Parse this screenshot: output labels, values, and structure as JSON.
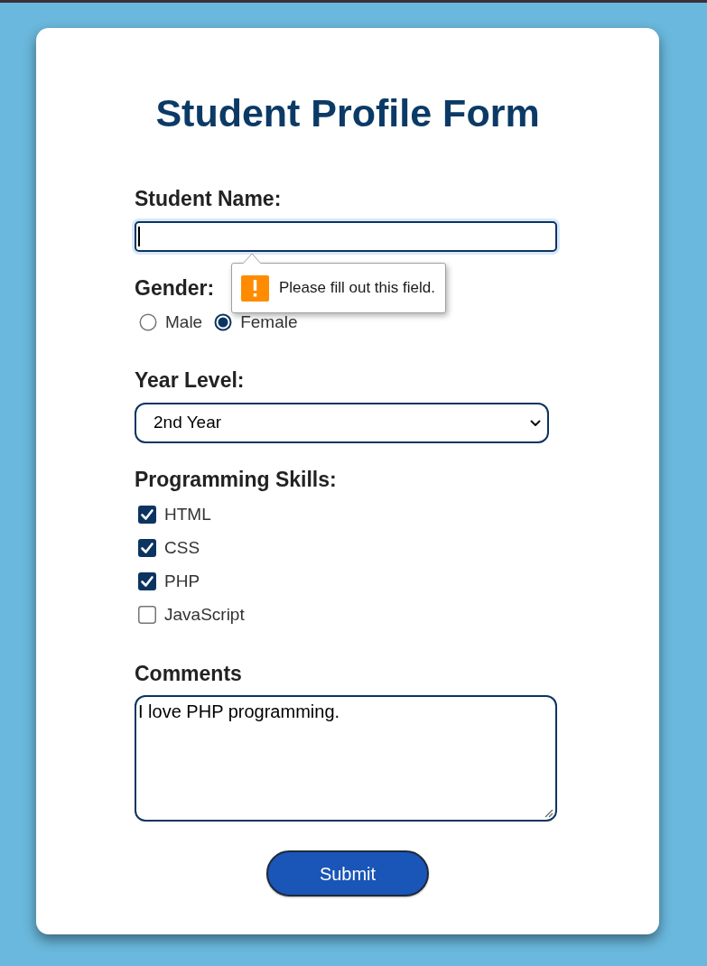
{
  "form": {
    "title": "Student Profile Form"
  },
  "student_name": {
    "label": "Student Name:",
    "focused": true
  },
  "validation_tooltip": {
    "message": "Please fill out this field."
  },
  "gender": {
    "label": "Gender:",
    "options": [
      {
        "label": "Male",
        "selected": false
      },
      {
        "label": "Female",
        "selected": true
      }
    ]
  },
  "year_level": {
    "label": "Year Level:",
    "value": "2nd Year"
  },
  "programming_skills": {
    "label": "Programming Skills:",
    "options": [
      {
        "label": "HTML",
        "checked": true
      },
      {
        "label": "CSS",
        "checked": true
      },
      {
        "label": "PHP",
        "checked": true
      },
      {
        "label": "JavaScript",
        "checked": false
      }
    ]
  },
  "comments": {
    "label": "Comments",
    "value": "I love PHP programming."
  },
  "submit_button": {
    "label": "Submit"
  }
}
